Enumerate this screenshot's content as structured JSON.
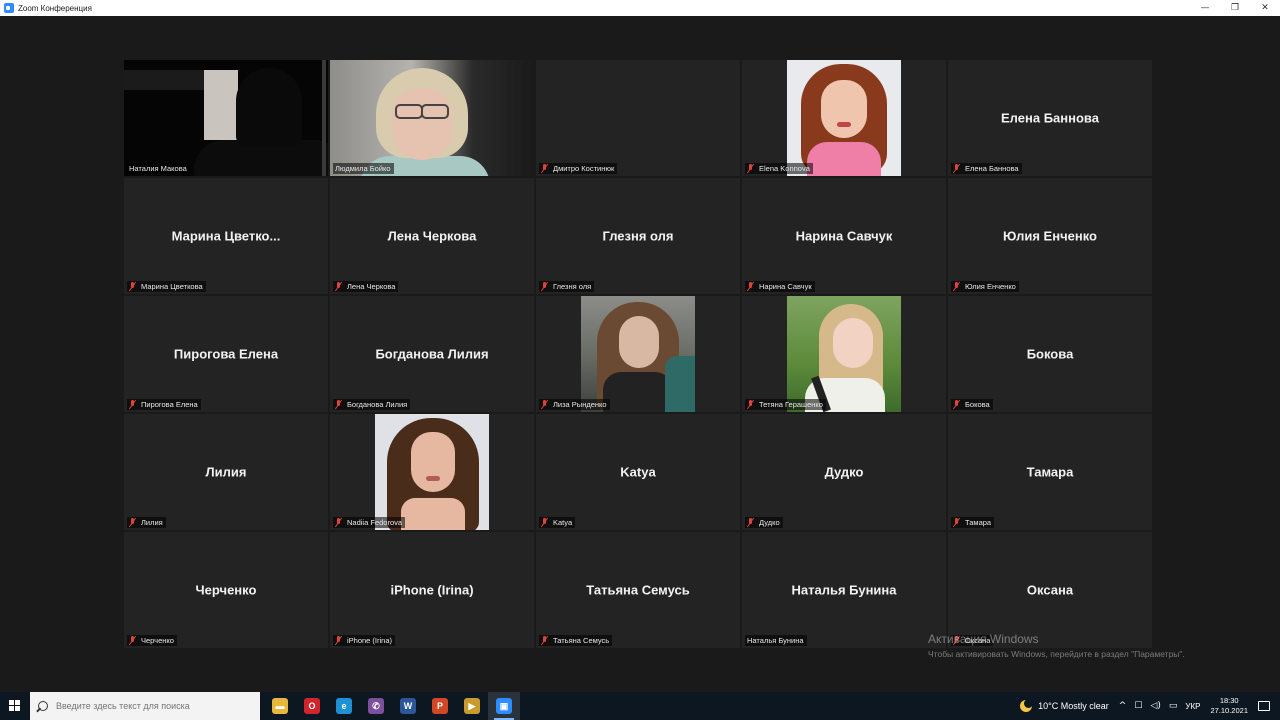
{
  "window": {
    "title": "Zoom Конференция",
    "controls": {
      "minimize": "—",
      "restore": "❐",
      "close": "✕"
    }
  },
  "participants": [
    {
      "display": "",
      "label": "Наталия Макова",
      "video": "dark",
      "active": true,
      "muted": false
    },
    {
      "display": "",
      "label": "Людмила Бойко",
      "video": "glasses",
      "muted": false
    },
    {
      "display": "",
      "label": "Дмитро Костинюк",
      "video": "none",
      "muted": true
    },
    {
      "display": "",
      "label": "Elena Konnova",
      "video": "redhair",
      "muted": true
    },
    {
      "display": "Елена Баннова",
      "label": "Елена Баннова",
      "muted": true
    },
    {
      "display": "Марина  Цветко...",
      "label": "Марина Цветкова",
      "muted": true
    },
    {
      "display": "Лена Черкова",
      "label": "Лена Черкова",
      "muted": true
    },
    {
      "display": "Глезня оля",
      "label": "Глезня оля",
      "muted": true
    },
    {
      "display": "Нарина Савчук",
      "label": "Нарина Савчук",
      "muted": true
    },
    {
      "display": "Юлия Енченко",
      "label": "Юлия Енченко",
      "muted": true
    },
    {
      "display": "Пирогова Елена",
      "label": "Пирогова Елена",
      "muted": true
    },
    {
      "display": "Богданова Лилия",
      "label": "Богданова Лилия",
      "muted": true
    },
    {
      "display": "",
      "label": "Лиза Рынденко",
      "video": "girl1",
      "muted": true
    },
    {
      "display": "",
      "label": "Тетяна Герашенко",
      "video": "girl2",
      "muted": true
    },
    {
      "display": "Бокова",
      "label": "Бокова",
      "muted": true
    },
    {
      "display": "Лилия",
      "label": "Лилия",
      "muted": true
    },
    {
      "display": "",
      "label": "Nadiia Fedorova",
      "video": "girl3",
      "muted": true
    },
    {
      "display": "Katya",
      "label": "Katya",
      "muted": true
    },
    {
      "display": "Дудко",
      "label": "Дудко",
      "muted": true
    },
    {
      "display": "Тамара",
      "label": "Тамара",
      "muted": true
    },
    {
      "display": "Черченко",
      "label": "Черченко",
      "muted": true
    },
    {
      "display": "iPhone (Irina)",
      "label": "iPhone (Irina)",
      "muted": true
    },
    {
      "display": "Татьяна Семусь",
      "label": "Татьяна Семусь",
      "muted": true
    },
    {
      "display": "Наталья Бунина",
      "label": "Наталья Бунина",
      "muted": false
    },
    {
      "display": "Оксана",
      "label": "Оксана",
      "muted": true
    }
  ],
  "watermark": {
    "title": "Активация Windows",
    "subtitle": "Чтобы активировать Windows, перейдите в раздел \"Параметры\"."
  },
  "taskbar": {
    "search_placeholder": "Введите здесь текст для поиска",
    "apps": [
      {
        "name": "file-explorer-icon",
        "glyph": "▬",
        "color": "#e8b83a"
      },
      {
        "name": "opera-icon",
        "glyph": "O",
        "color": "#d3242c"
      },
      {
        "name": "edge-icon",
        "glyph": "e",
        "color": "#1f8fd6"
      },
      {
        "name": "viber-icon",
        "glyph": "✆",
        "color": "#7b519d"
      },
      {
        "name": "word-icon",
        "glyph": "W",
        "color": "#2b579a"
      },
      {
        "name": "powerpoint-icon",
        "glyph": "P",
        "color": "#d24726"
      },
      {
        "name": "media-icon",
        "glyph": "▶",
        "color": "#c89b2f"
      },
      {
        "name": "zoom-icon",
        "glyph": "▣",
        "color": "#2d8cff",
        "active": true
      }
    ],
    "weather": "10°C  Mostly clear",
    "tray_glyphs": [
      "^",
      "☐",
      "◁)",
      "▭"
    ],
    "language": "УКР",
    "time": "18:30",
    "date": "27.10.2021"
  }
}
